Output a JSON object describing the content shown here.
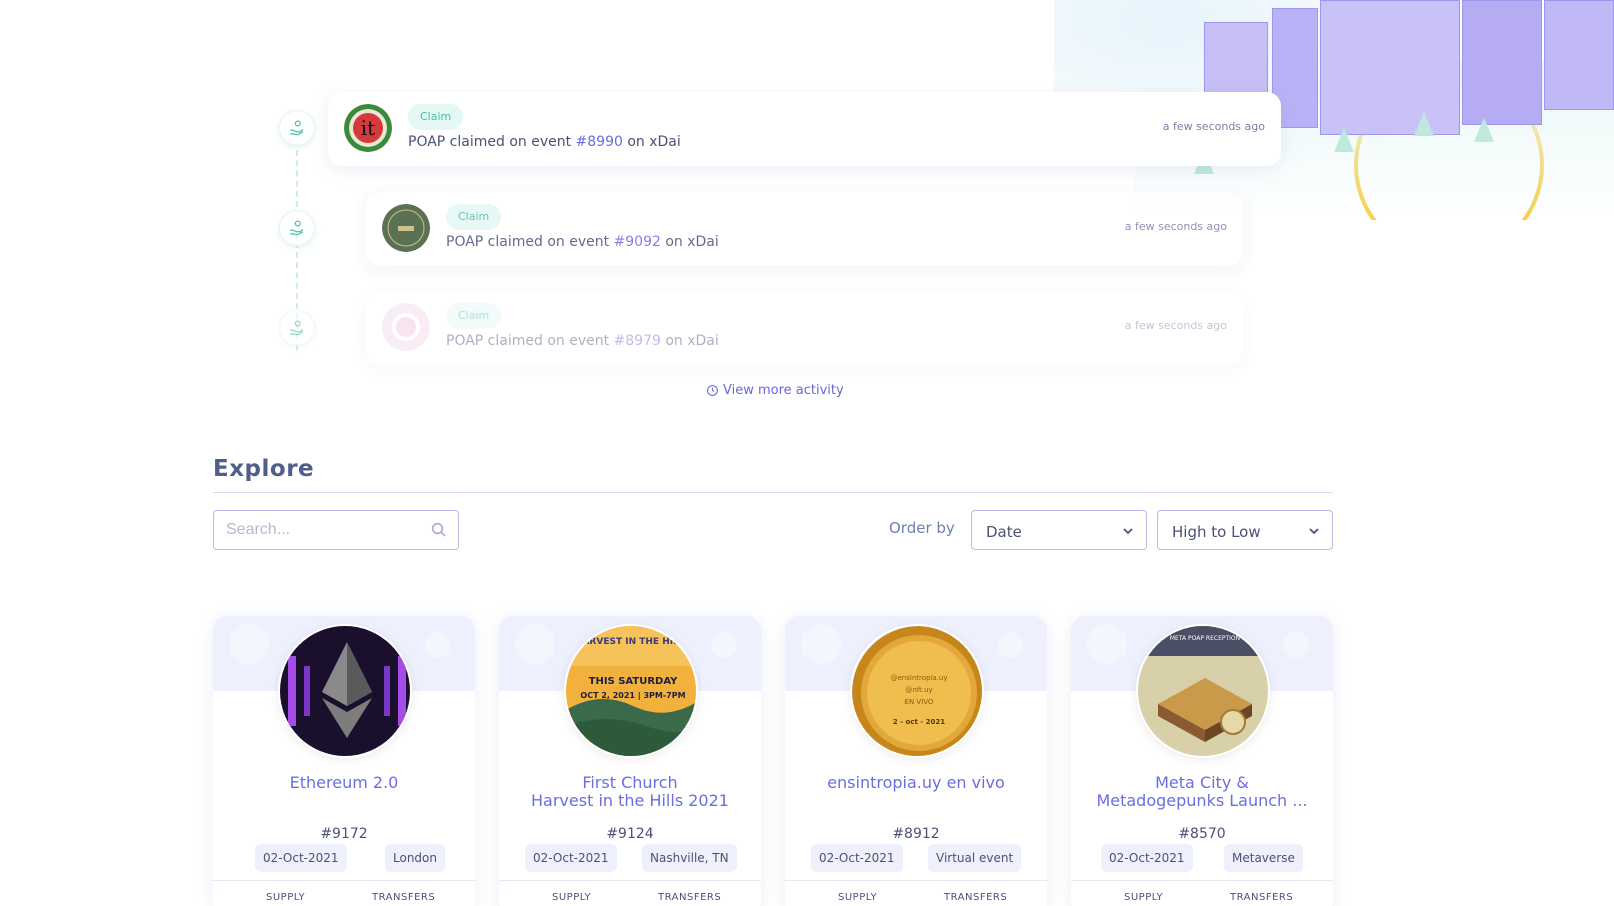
{
  "activity": {
    "items": [
      {
        "badge": "Claim",
        "prefix": "POAP claimed on event ",
        "event": "#8990",
        "suffix": " on xDai",
        "time": "a few seconds ago"
      },
      {
        "badge": "Claim",
        "prefix": "POAP claimed on event ",
        "event": "#9092",
        "suffix": " on xDai",
        "time": "a few seconds ago"
      },
      {
        "badge": "Claim",
        "prefix": "POAP claimed on event ",
        "event": "#8979",
        "suffix": " on xDai",
        "time": "a few seconds ago"
      }
    ],
    "view_more": "View more activity"
  },
  "explore": {
    "title": "Explore",
    "search_placeholder": "Search...",
    "order_label": "Order by",
    "order_field": "Date",
    "order_direction": "High to Low"
  },
  "cards": [
    {
      "title": "Ethereum 2.0",
      "id": "#9172",
      "date": "02-Oct-2021",
      "location": "London",
      "supply_label": "SUPPLY",
      "transfers_label": "TRANSFERS"
    },
    {
      "title": "First Church\nHarvest in the Hills 2021",
      "id": "#9124",
      "date": "02-Oct-2021",
      "location": "Nashville, TN",
      "supply_label": "SUPPLY",
      "transfers_label": "TRANSFERS",
      "image_text": {
        "top": "HARVEST IN THE HILLS",
        "line1": "THIS SATURDAY",
        "line2": "OCT 2, 2021 | 3PM-7PM"
      }
    },
    {
      "title": "ensintropia.uy en vivo",
      "id": "#8912",
      "date": "02-Oct-2021",
      "location": "Virtual event",
      "supply_label": "SUPPLY",
      "transfers_label": "TRANSFERS",
      "image_text": {
        "line1": "@ensintropia.uy",
        "line2": "@nft.uy",
        "line3": "EN VIVO",
        "line4": "2 - oct - 2021"
      }
    },
    {
      "title": "Meta City &\nMetadogepunks Launch ...",
      "id": "#8570",
      "date": "02-Oct-2021",
      "location": "Metaverse",
      "supply_label": "SUPPLY",
      "transfers_label": "TRANSFERS",
      "image_text": {
        "top": "META POAP RECEPTION"
      }
    }
  ],
  "colors": {
    "accent": "#6c6ce0",
    "claim_badge_bg": "#e4f8f4",
    "claim_badge_text": "#49c0a8"
  }
}
